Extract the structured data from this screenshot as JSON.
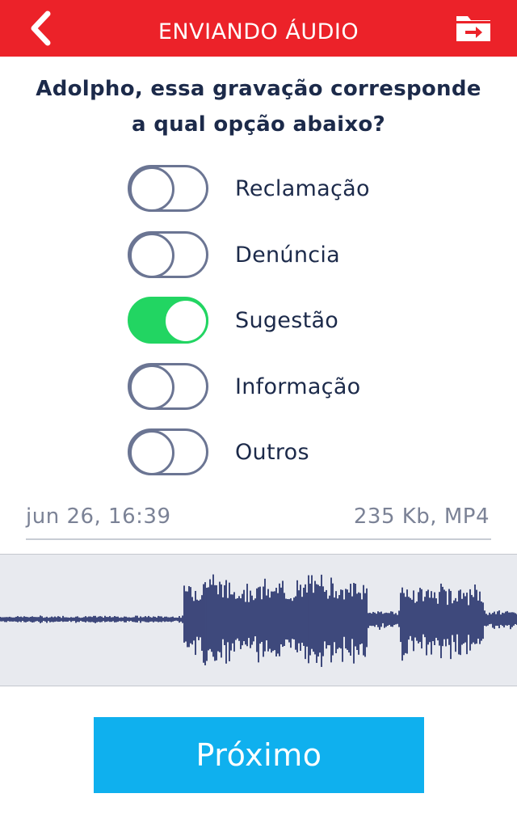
{
  "header": {
    "title": "ENVIANDO ÁUDIO",
    "back_icon": "chevron-left-icon",
    "folder_icon": "folder-move-icon",
    "color": "#ec2229"
  },
  "question": {
    "line1": "Adolpho, essa gravação corresponde",
    "line2": "a qual opção abaixo?"
  },
  "options": [
    {
      "label": "Reclamação",
      "selected": false
    },
    {
      "label": "Denúncia",
      "selected": false
    },
    {
      "label": "Sugestão",
      "selected": true
    },
    {
      "label": "Informação",
      "selected": false
    },
    {
      "label": "Outros",
      "selected": false
    }
  ],
  "recording": {
    "date": "jun 26, 16:39",
    "size_format": "235 Kb, MP4",
    "waveform_color": "#14205e"
  },
  "next_button": {
    "label": "Próximo",
    "color": "#0fb0ee"
  },
  "toggle_on_color": "#22d562"
}
